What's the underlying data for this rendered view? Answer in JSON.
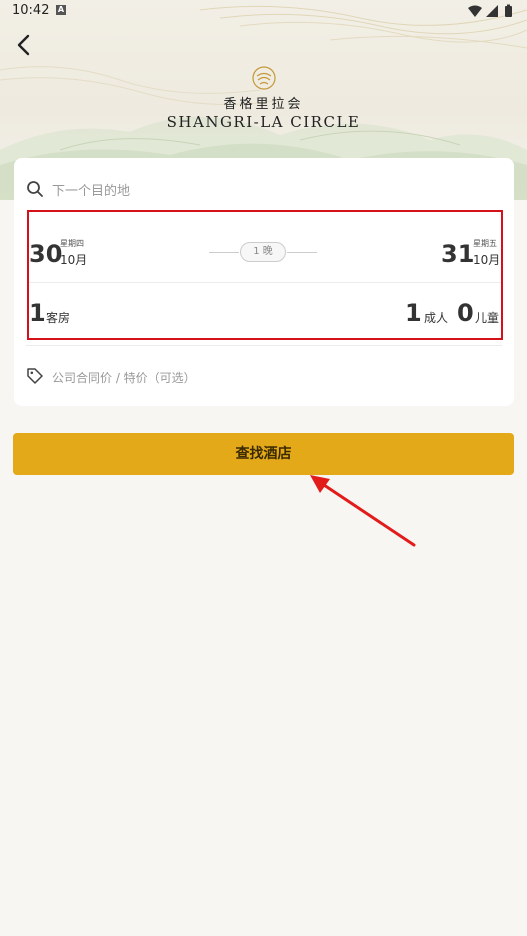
{
  "status_bar": {
    "time": "10:42",
    "notification_glyph": "A",
    "icons": [
      "wifi-icon",
      "signal-icon",
      "battery-icon"
    ]
  },
  "header": {
    "back_icon": "back-arrow-icon",
    "logo_mark": "shangri-la-emblem",
    "brand_cn": "香格里拉会",
    "brand_en": "SHANGRI-LA CIRCLE"
  },
  "search": {
    "icon": "search-icon",
    "placeholder": "下一个目的地"
  },
  "dates": {
    "checkin": {
      "day": "30",
      "weekday": "星期四",
      "month": "10月"
    },
    "nights": "1 晚",
    "checkout": {
      "day": "31",
      "weekday": "星期五",
      "month": "10月"
    }
  },
  "guests": {
    "rooms": "1",
    "rooms_label": "客房",
    "adults": "1",
    "adults_label": "成人",
    "children": "0",
    "children_label": "儿童"
  },
  "promo": {
    "icon": "tag-icon",
    "placeholder": "公司合同价 / 特价（可选）"
  },
  "action": {
    "search_label": "查找酒店"
  },
  "colors": {
    "accent": "#e3a918",
    "highlight": "#d6101a",
    "background": "#f8f6f3"
  }
}
